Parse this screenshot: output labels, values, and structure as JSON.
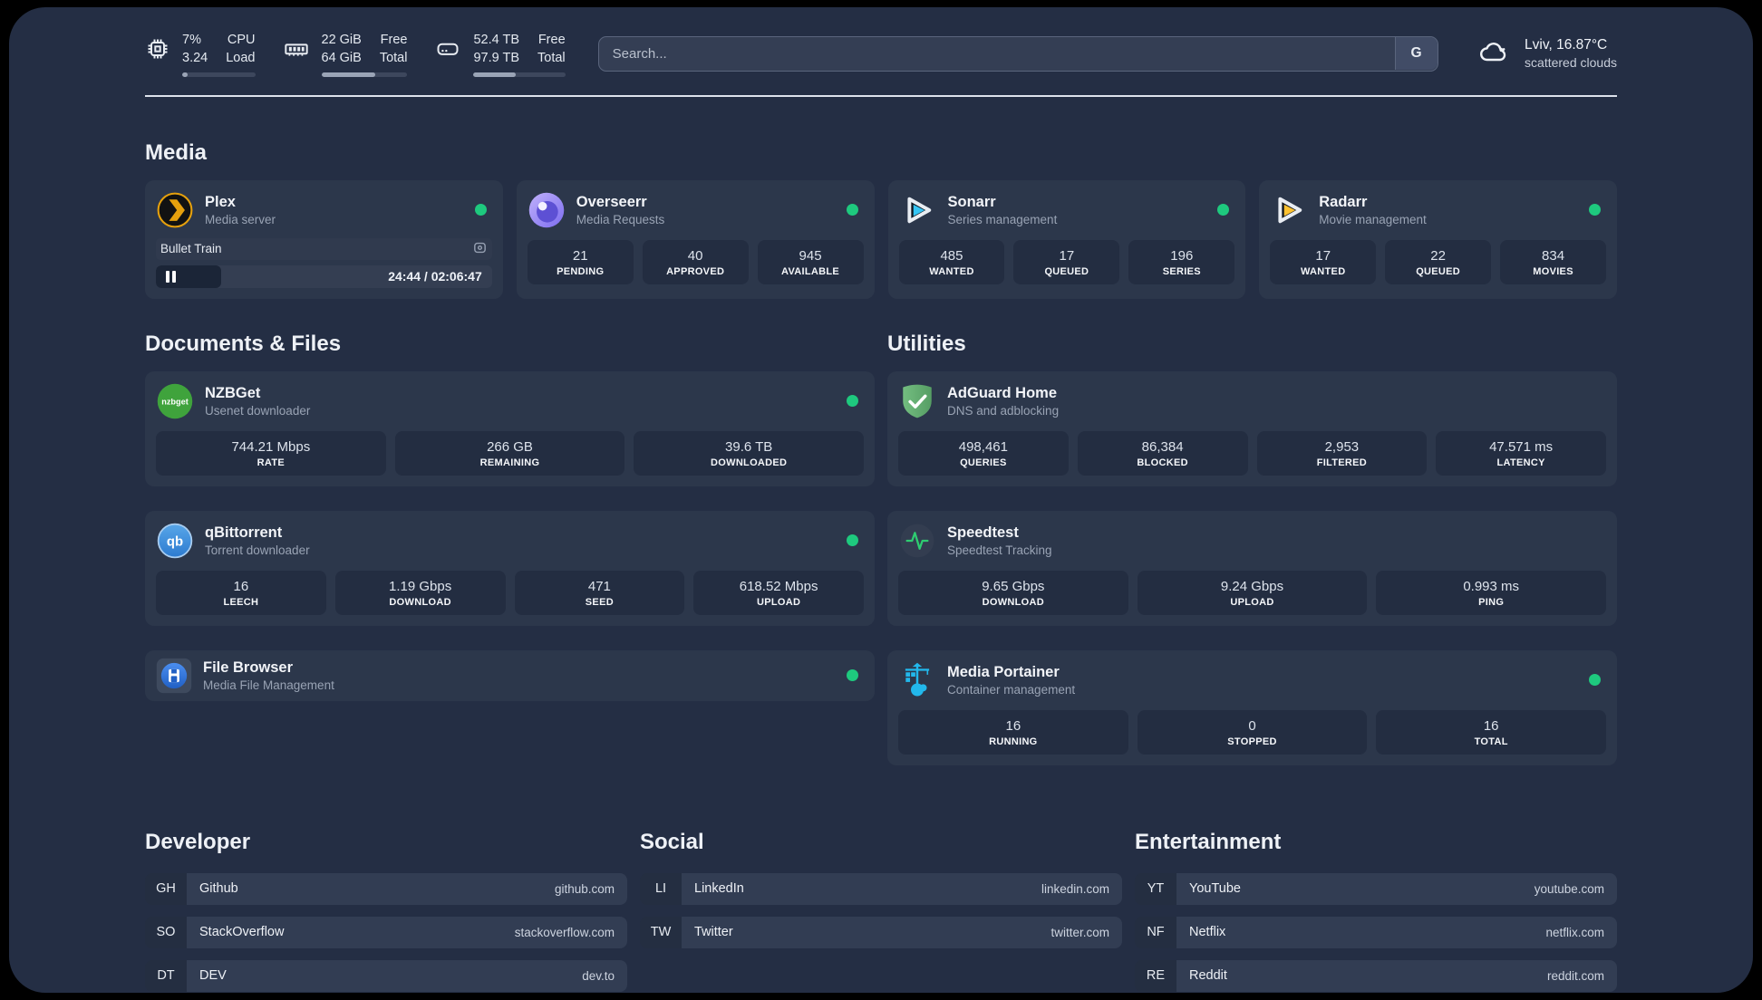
{
  "header": {
    "stats": [
      {
        "value_top": "7%",
        "value_bottom": "3.24",
        "label_top": "CPU",
        "label_bottom": "Load",
        "progress": 8
      },
      {
        "value_top": "22 GiB",
        "value_bottom": "64 GiB",
        "label_top": "Free",
        "label_bottom": "Total",
        "progress": 63
      },
      {
        "value_top": "52.4 TB",
        "value_bottom": "97.9 TB",
        "label_top": "Free",
        "label_bottom": "Total",
        "progress": 46
      }
    ],
    "search": {
      "placeholder": "Search...",
      "provider_button": "G"
    },
    "weather": {
      "summary": "Lviv, 16.87°C",
      "condition": "scattered clouds"
    }
  },
  "media": {
    "title": "Media",
    "plex": {
      "title": "Plex",
      "subtitle": "Media server",
      "online": true,
      "now_playing": {
        "name": "Bullet Train",
        "time": "24:44 / 02:06:47",
        "progress": 19.5
      }
    },
    "overseerr": {
      "title": "Overseerr",
      "subtitle": "Media Requests",
      "online": true,
      "stats": [
        {
          "value": "21",
          "label": "PENDING"
        },
        {
          "value": "40",
          "label": "APPROVED"
        },
        {
          "value": "945",
          "label": "AVAILABLE"
        }
      ]
    },
    "sonarr": {
      "title": "Sonarr",
      "subtitle": "Series management",
      "online": true,
      "stats": [
        {
          "value": "485",
          "label": "WANTED"
        },
        {
          "value": "17",
          "label": "QUEUED"
        },
        {
          "value": "196",
          "label": "SERIES"
        }
      ]
    },
    "radarr": {
      "title": "Radarr",
      "subtitle": "Movie management",
      "online": true,
      "stats": [
        {
          "value": "17",
          "label": "WANTED"
        },
        {
          "value": "22",
          "label": "QUEUED"
        },
        {
          "value": "834",
          "label": "MOVIES"
        }
      ]
    }
  },
  "documents": {
    "title": "Documents & Files",
    "nzbget": {
      "title": "NZBGet",
      "subtitle": "Usenet downloader",
      "online": true,
      "stats": [
        {
          "value": "744.21 Mbps",
          "label": "RATE"
        },
        {
          "value": "266 GB",
          "label": "REMAINING"
        },
        {
          "value": "39.6 TB",
          "label": "DOWNLOADED"
        }
      ]
    },
    "qbittorrent": {
      "title": "qBittorrent",
      "subtitle": "Torrent downloader",
      "online": true,
      "stats": [
        {
          "value": "16",
          "label": "LEECH"
        },
        {
          "value": "1.19 Gbps",
          "label": "DOWNLOAD"
        },
        {
          "value": "471",
          "label": "SEED"
        },
        {
          "value": "618.52 Mbps",
          "label": "UPLOAD"
        }
      ]
    },
    "filebrowser": {
      "title": "File Browser",
      "subtitle": "Media File Management",
      "online": true
    }
  },
  "utilities": {
    "title": "Utilities",
    "adguard": {
      "title": "AdGuard Home",
      "subtitle": "DNS and adblocking",
      "online": false,
      "stats": [
        {
          "value": "498,461",
          "label": "QUERIES"
        },
        {
          "value": "86,384",
          "label": "BLOCKED"
        },
        {
          "value": "2,953",
          "label": "FILTERED"
        },
        {
          "value": "47.571 ms",
          "label": "LATENCY"
        }
      ]
    },
    "speedtest": {
      "title": "Speedtest",
      "subtitle": "Speedtest Tracking",
      "online": false,
      "stats": [
        {
          "value": "9.65 Gbps",
          "label": "DOWNLOAD"
        },
        {
          "value": "9.24 Gbps",
          "label": "UPLOAD"
        },
        {
          "value": "0.993 ms",
          "label": "PING"
        }
      ]
    },
    "portainer": {
      "title": "Media Portainer",
      "subtitle": "Container management",
      "online": true,
      "stats": [
        {
          "value": "16",
          "label": "RUNNING"
        },
        {
          "value": "0",
          "label": "STOPPED"
        },
        {
          "value": "16",
          "label": "TOTAL"
        }
      ]
    }
  },
  "bookmarks": {
    "developer": {
      "title": "Developer",
      "links": [
        {
          "abbr": "GH",
          "name": "Github",
          "url": "github.com"
        },
        {
          "abbr": "SO",
          "name": "StackOverflow",
          "url": "stackoverflow.com"
        },
        {
          "abbr": "DT",
          "name": "DEV",
          "url": "dev.to"
        }
      ]
    },
    "social": {
      "title": "Social",
      "links": [
        {
          "abbr": "LI",
          "name": "LinkedIn",
          "url": "linkedin.com"
        },
        {
          "abbr": "TW",
          "name": "Twitter",
          "url": "twitter.com"
        }
      ]
    },
    "entertainment": {
      "title": "Entertainment",
      "links": [
        {
          "abbr": "YT",
          "name": "YouTube",
          "url": "youtube.com"
        },
        {
          "abbr": "NF",
          "name": "Netflix",
          "url": "netflix.com"
        },
        {
          "abbr": "RE",
          "name": "Reddit",
          "url": "reddit.com"
        }
      ]
    }
  },
  "colors": {
    "status_online": "#1ec97e",
    "page_bg": "#242e44",
    "card_bg": "#2c374b",
    "stat_box_bg": "#232d41"
  }
}
